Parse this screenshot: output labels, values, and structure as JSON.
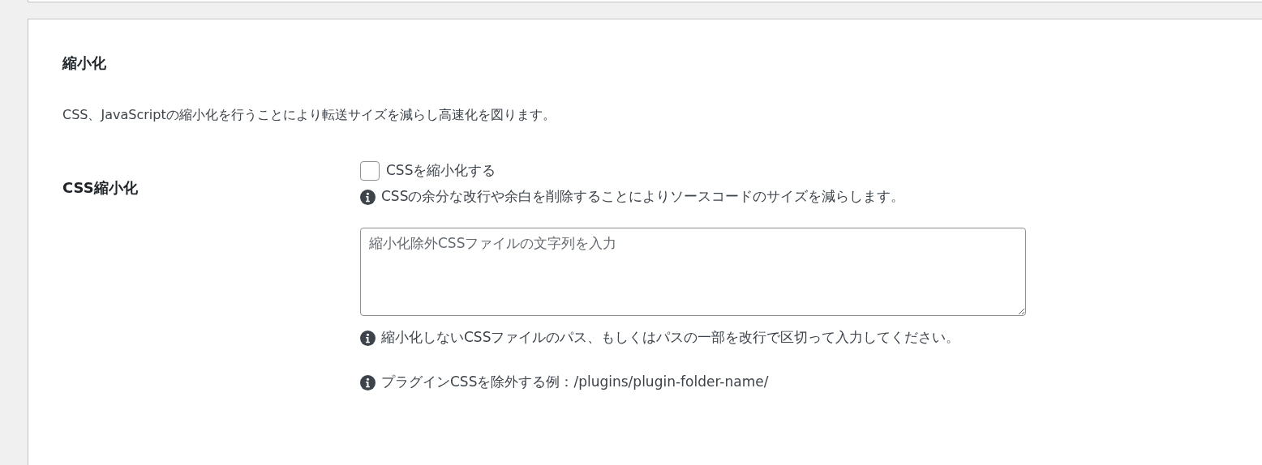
{
  "section": {
    "title": "縮小化",
    "description": "CSS、JavaScriptの縮小化を行うことにより転送サイズを減らし高速化を図ります。"
  },
  "settings": [
    {
      "label": "CSS縮小化",
      "checkbox": {
        "label": "CSSを縮小化する",
        "checked": false
      },
      "hint": "CSSの余分な改行や余白を削除することによりソースコードのサイズを減らします。",
      "textarea": {
        "placeholder": "縮小化除外CSSファイルの文字列を入力"
      },
      "notes": [
        "縮小化しないCSSファイルのパス、もしくはパスの一部を改行で区切って入力してください。",
        "プラグインCSSを除外する例：/plugins/plugin-folder-name/"
      ]
    }
  ]
}
